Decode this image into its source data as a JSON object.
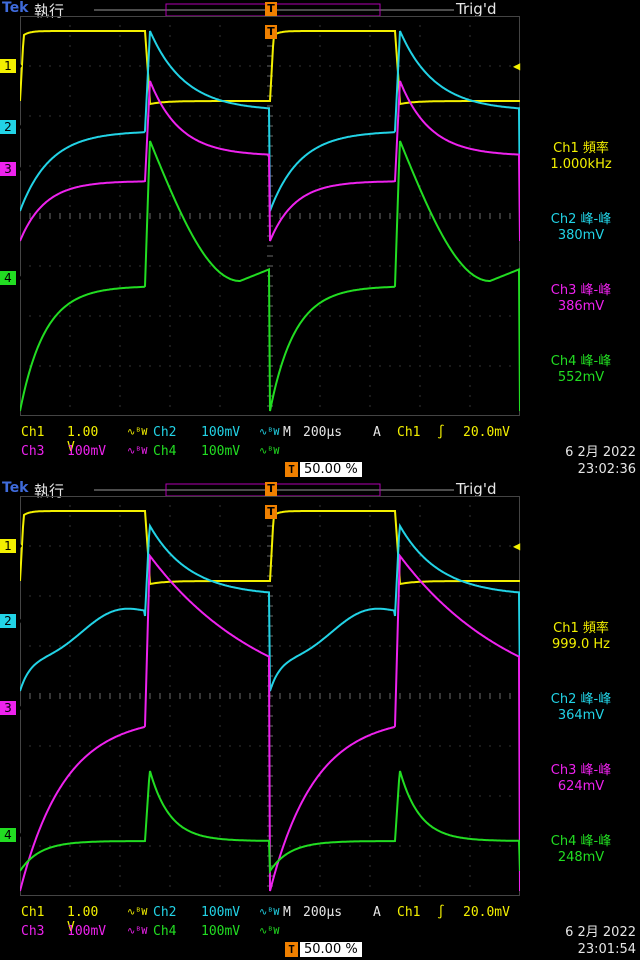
{
  "screens": [
    {
      "brand": "Tek",
      "run_state": "執行",
      "trig_state": "Trig'd",
      "trig_marker": "T",
      "channel_markers": [
        "1",
        "2",
        "3",
        "4"
      ],
      "measurements": [
        {
          "label": "Ch1 頻率",
          "value": "1.000kHz"
        },
        {
          "label": "Ch2 峰-峰",
          "value": "380mV"
        },
        {
          "label": "Ch3 峰-峰",
          "value": "386mV"
        },
        {
          "label": "Ch4 峰-峰",
          "value": "552mV"
        }
      ],
      "ch1_label": "Ch1",
      "ch1_scale": "1.00 V",
      "ch1_coupling": "∿ᴮW",
      "ch2_label": "Ch2",
      "ch2_scale": "100mV",
      "ch2_coupling": "∿ᴮW",
      "ch3_label": "Ch3",
      "ch3_scale": "100mV",
      "ch3_coupling": "∿ᴮW",
      "ch4_label": "Ch4",
      "ch4_scale": "100mV",
      "ch4_coupling": "∿ᴮW",
      "timebase_label": "M",
      "timebase": "200µs",
      "acq_mode": "A",
      "trig_source": "Ch1",
      "trig_slope": "∫",
      "trig_level": "20.0mV",
      "trig_pct": "50.00 %",
      "date": "6 2月  2022",
      "time": "23:02:36"
    },
    {
      "brand": "Tek",
      "run_state": "執行",
      "trig_state": "Trig'd",
      "trig_marker": "T",
      "channel_markers": [
        "1",
        "2",
        "3",
        "4"
      ],
      "measurements": [
        {
          "label": "Ch1 頻率",
          "value": "999.0 Hz"
        },
        {
          "label": "Ch2 峰-峰",
          "value": "364mV"
        },
        {
          "label": "Ch3 峰-峰",
          "value": "624mV"
        },
        {
          "label": "Ch4 峰-峰",
          "value": "248mV"
        }
      ],
      "ch1_label": "Ch1",
      "ch1_scale": "1.00 V",
      "ch1_coupling": "∿ᴮW",
      "ch2_label": "Ch2",
      "ch2_scale": "100mV",
      "ch2_coupling": "∿ᴮW",
      "ch3_label": "Ch3",
      "ch3_scale": "100mV",
      "ch3_coupling": "∿ᴮW",
      "ch4_label": "Ch4",
      "ch4_scale": "100mV",
      "ch4_coupling": "∿ᴮW",
      "timebase_label": "M",
      "timebase": "200µs",
      "acq_mode": "A",
      "trig_source": "Ch1",
      "trig_slope": "∫",
      "trig_level": "20.0mV",
      "trig_pct": "50.00 %",
      "date": "6 2月  2022",
      "time": "23:01:54"
    }
  ],
  "colors": {
    "ch1": "#f3f000",
    "ch2": "#22d3e6",
    "ch3": "#ee22ee",
    "ch4": "#22dd22",
    "trigger": "#f08000",
    "grid": "#505050"
  }
}
